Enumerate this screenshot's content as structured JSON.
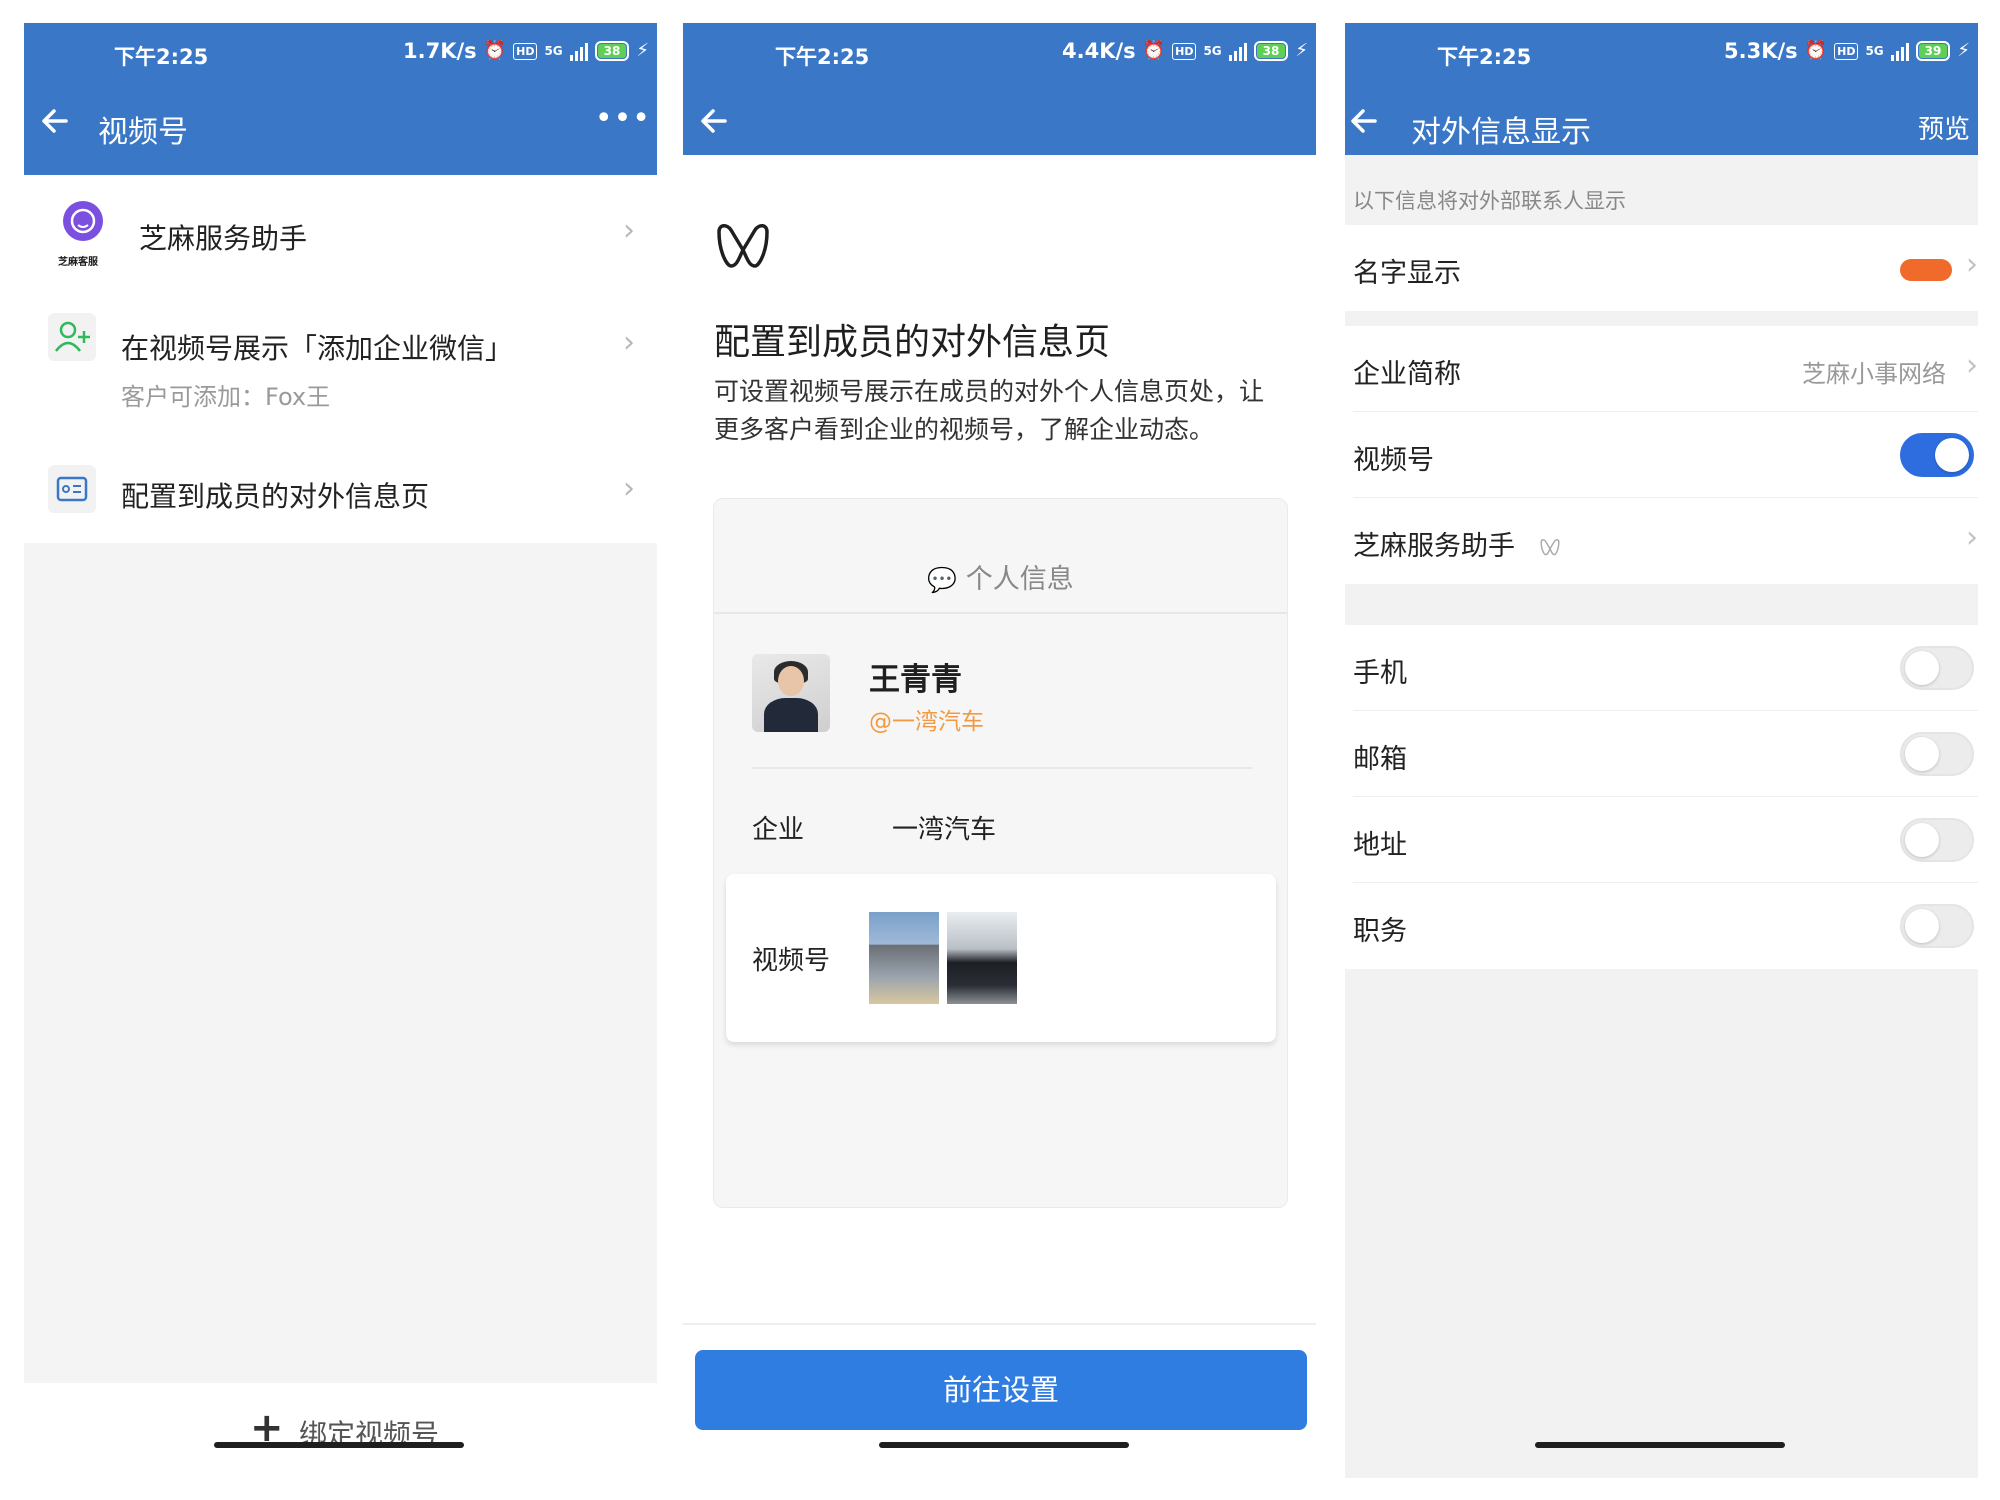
{
  "status": {
    "time": "下午2:25",
    "p1_speed": "1.7K/s",
    "p1_battery": "38",
    "p2_speed": "4.4K/s",
    "p2_battery": "38",
    "p3_speed": "5.3K/s",
    "p3_battery": "39",
    "network": "5G",
    "hd": "HD"
  },
  "p1": {
    "title": "视频号",
    "more": "•••",
    "account": {
      "name": "芝麻服务助手",
      "logo_caption": "芝麻客服"
    },
    "show_add_wechat": {
      "label": "在视频号展示「添加企业微信」",
      "sub": "客户可添加：Fox王"
    },
    "config_page": {
      "label": "配置到成员的对外信息页"
    },
    "bind_button": "绑定视频号",
    "bind_icon": "+"
  },
  "p2": {
    "heading": "配置到成员的对外信息页",
    "description": "可设置视频号展示在成员的对外个人信息页处，让更多客户看到企业的视频号，了解企业动态。",
    "card_title": "个人信息",
    "person_name": "王青青",
    "person_company": "@一湾汽车",
    "company_label": "企业",
    "company_value": "一湾汽车",
    "channel_label": "视频号",
    "go_button": "前往设置"
  },
  "p3": {
    "title": "对外信息显示",
    "preview": "预览",
    "note": "以下信息将对外部联系人显示",
    "name_display": "名字显示",
    "company_short": {
      "label": "企业简称",
      "value": "芝麻小事网络"
    },
    "channel": {
      "label": "视频号",
      "enabled": true
    },
    "channel_account": "芝麻服务助手",
    "phone": {
      "label": "手机",
      "enabled": false
    },
    "email": {
      "label": "邮箱",
      "enabled": false
    },
    "address": {
      "label": "地址",
      "enabled": false
    },
    "position": {
      "label": "职务",
      "enabled": false
    }
  },
  "colors": {
    "header": "#3a77c7",
    "accent_blue": "#2f7de1",
    "toggle_on": "#2d6de0",
    "orange_text": "#f29a43",
    "redaction": "#f06a2b"
  }
}
